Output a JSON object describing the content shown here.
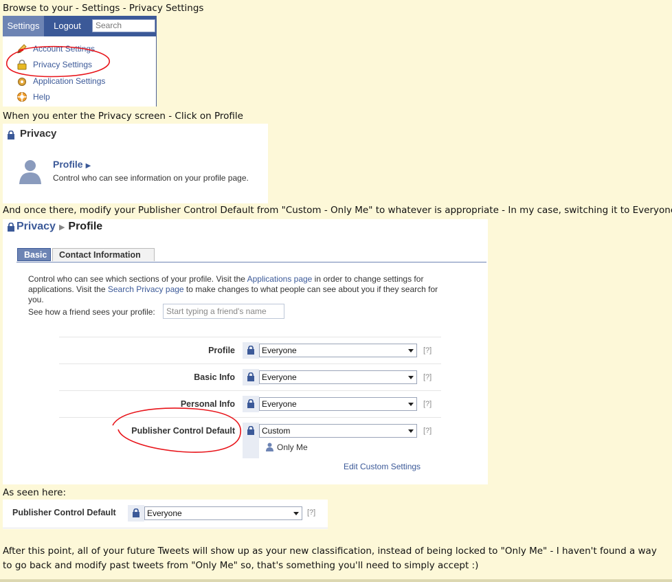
{
  "captions": {
    "step1": "Browse to your - Settings - Privacy Settings",
    "step2": "When you enter the Privacy screen - Click on Profile",
    "step3": "And once there, modify your Publisher Control Default from \"Custom - Only Me\" to whatever is appropriate - In my case, switching it to Everyone",
    "step4": "As seen here:",
    "conclusion": "After this point, all of your future Tweets will show up as your new classification, instead of being locked to \"Only Me\" - I haven't found a way to go back and modify past tweets from \"Only Me\" so, that's something you'll need to simply accept :)"
  },
  "settings_menu": {
    "menubar": {
      "settings": "Settings",
      "logout": "Logout",
      "search_placeholder": "Search"
    },
    "items": [
      {
        "label": "Account Settings",
        "icon": "pencil-icon"
      },
      {
        "label": "Privacy Settings",
        "icon": "lock-icon"
      },
      {
        "label": "Application Settings",
        "icon": "gear-icon"
      },
      {
        "label": "Help",
        "icon": "lifebuoy-icon"
      }
    ]
  },
  "privacy_screen": {
    "title": "Privacy",
    "profile_link": "Profile",
    "profile_desc": "Control who can see information on your profile page."
  },
  "profile_privacy": {
    "breadcrumb": [
      "Privacy",
      "Profile"
    ],
    "tabs": [
      "Basic",
      "Contact Information"
    ],
    "intro_parts": {
      "a": "Control who can see which sections of your profile. Visit the ",
      "link1": "Applications page",
      "b": " in order to change settings for applications. Visit the ",
      "link2": "Search Privacy page",
      "c": " to make changes to what people can see about you if they search for you."
    },
    "see_label": "See how a friend sees your profile:",
    "see_placeholder": "Start typing a friend's name",
    "rows": [
      {
        "label": "Profile",
        "value": "Everyone",
        "help": "[?]"
      },
      {
        "label": "Basic Info",
        "value": "Everyone",
        "help": "[?]"
      },
      {
        "label": "Personal Info",
        "value": "Everyone",
        "help": "[?]"
      },
      {
        "label": "Publisher Control Default",
        "value": "Custom",
        "help": "[?]"
      }
    ],
    "custom_detail": "Only Me",
    "edit_custom": "Edit Custom Settings"
  },
  "result_row": {
    "label": "Publisher Control Default",
    "value": "Everyone",
    "help": "[?]"
  },
  "colors": {
    "facebook_blue": "#3b5998",
    "tab_blue": "#6d84b4",
    "annotation_red": "#e8141a",
    "page_bg": "#fdf8d8"
  }
}
